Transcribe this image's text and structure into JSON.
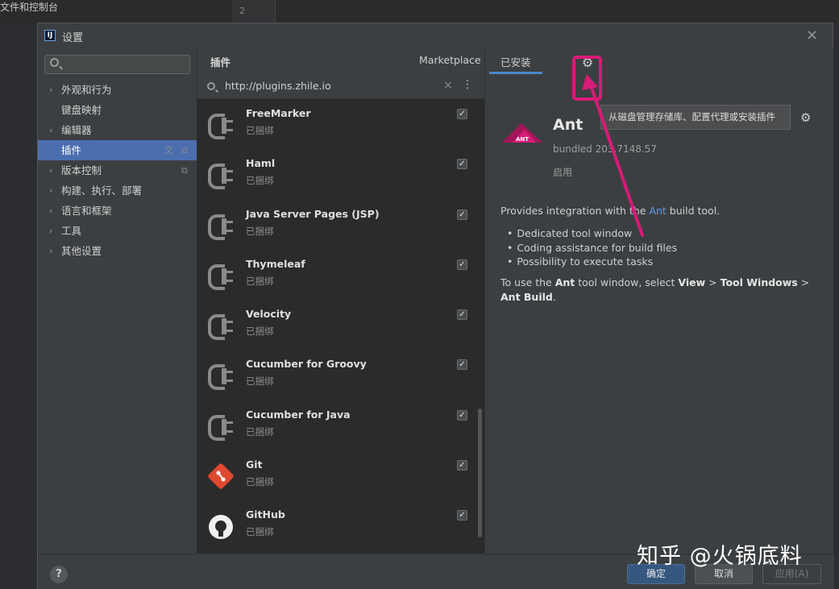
{
  "background": {
    "window_title": "文件和控制台",
    "gutter_line": "2"
  },
  "dialog": {
    "title": "设置",
    "app_icon_text": "IJ",
    "close_label": "×"
  },
  "nav": {
    "search_placeholder": "",
    "items": [
      {
        "label": "外观和行为",
        "arrow": "›",
        "selected": false
      },
      {
        "label": "键盘映射",
        "arrow": "",
        "selected": false
      },
      {
        "label": "编辑器",
        "arrow": "›",
        "selected": false
      },
      {
        "label": "插件",
        "arrow": "",
        "selected": true
      },
      {
        "label": "版本控制",
        "arrow": "›",
        "selected": false
      },
      {
        "label": "构建、执行、部署",
        "arrow": "›",
        "selected": false
      },
      {
        "label": "语言和框架",
        "arrow": "›",
        "selected": false
      },
      {
        "label": "工具",
        "arrow": "›",
        "selected": false
      },
      {
        "label": "其他设置",
        "arrow": "›",
        "selected": false
      }
    ]
  },
  "plugins": {
    "header": "插件",
    "search_value": "http://plugins.zhile.io",
    "clear_label": "×",
    "more_label": "⋮",
    "list": [
      {
        "name": "FreeMarker",
        "status": "已捆绑",
        "checked": true,
        "icon": "plug-icon"
      },
      {
        "name": "Haml",
        "status": "已捆绑",
        "checked": true,
        "icon": "plug-icon"
      },
      {
        "name": "Java Server Pages (JSP)",
        "status": "已捆绑",
        "checked": true,
        "icon": "plug-icon"
      },
      {
        "name": "Thymeleaf",
        "status": "已捆绑",
        "checked": true,
        "icon": "plug-icon"
      },
      {
        "name": "Velocity",
        "status": "已捆绑",
        "checked": true,
        "icon": "plug-icon"
      },
      {
        "name": "Cucumber for Groovy",
        "status": "已捆绑",
        "checked": true,
        "icon": "plug-icon"
      },
      {
        "name": "Cucumber for Java",
        "status": "已捆绑",
        "checked": true,
        "icon": "plug-icon"
      },
      {
        "name": "Git",
        "status": "已捆绑",
        "checked": true,
        "icon": "git-icon"
      },
      {
        "name": "GitHub",
        "status": "已捆绑",
        "checked": true,
        "icon": "github-icon"
      }
    ],
    "check_glyph": "✓"
  },
  "tabs": {
    "marketplace": "Marketplace",
    "installed": "已安装",
    "active": "installed"
  },
  "detail": {
    "tooltip": "从磁盘管理存储库、配置代理或安装插件",
    "name": "Ant",
    "version": "bundled 203.7148.57",
    "state": "启用",
    "desc_pre": "Provides integration with the ",
    "desc_link": "Ant",
    "desc_post": " build tool.",
    "bullets": [
      "Dedicated tool window",
      "Coding assistance for build files",
      "Possibility to execute tasks"
    ],
    "usage_parts": {
      "p1": "To use the ",
      "b1": "Ant",
      "p2": " tool window, select ",
      "b2": "View",
      "p3": " > ",
      "b3": "Tool Windows",
      "p4": " > ",
      "b4": "Ant Build",
      "p5": "."
    }
  },
  "footer": {
    "help": "?",
    "ok": "确定",
    "cancel": "取消",
    "apply": "应用(A)"
  },
  "watermark": "知乎 @火锅底料",
  "colors": {
    "accent": "#4b6eaf",
    "highlight": "#d81b77",
    "link": "#589df6"
  }
}
